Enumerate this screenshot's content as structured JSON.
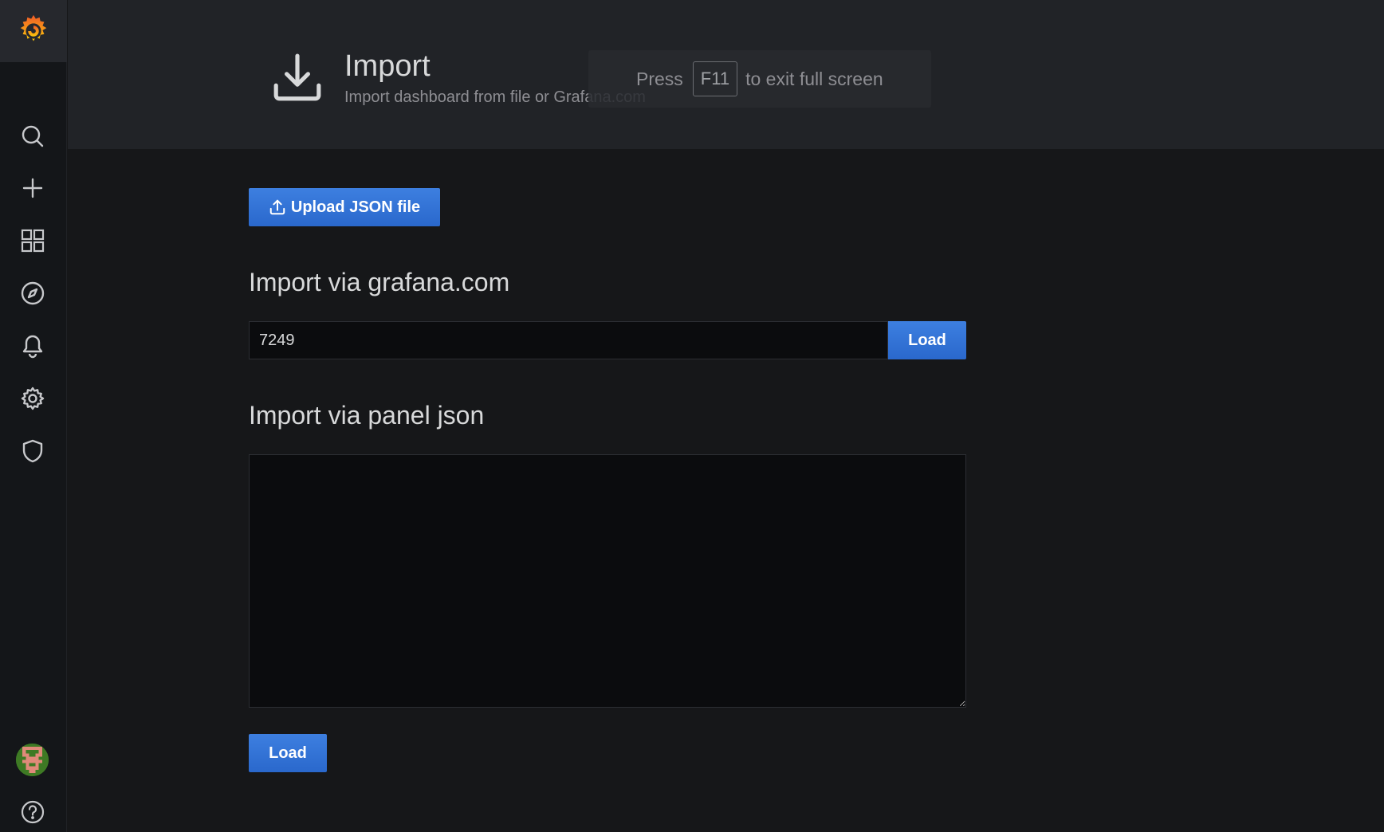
{
  "header": {
    "title": "Import",
    "subtitle": "Import dashboard from file or Grafana.com"
  },
  "fullscreen_notice": {
    "prefix": "Press",
    "key": "F11",
    "suffix": "to exit full screen"
  },
  "upload": {
    "label": "Upload JSON file"
  },
  "grafana_com": {
    "title": "Import via grafana.com",
    "value": "7249",
    "load_label": "Load"
  },
  "panel_json": {
    "title": "Import via panel json",
    "value": "",
    "load_label": "Load"
  },
  "sidebar": {
    "icons": [
      "search-icon",
      "plus-icon",
      "dashboards-icon",
      "explore-icon",
      "alerting-icon",
      "configuration-icon",
      "shield-icon",
      "help-icon"
    ]
  },
  "colors": {
    "accent": "#3274d9",
    "brand_orange": "#f05a28",
    "brand_yellow": "#fbca0a"
  }
}
